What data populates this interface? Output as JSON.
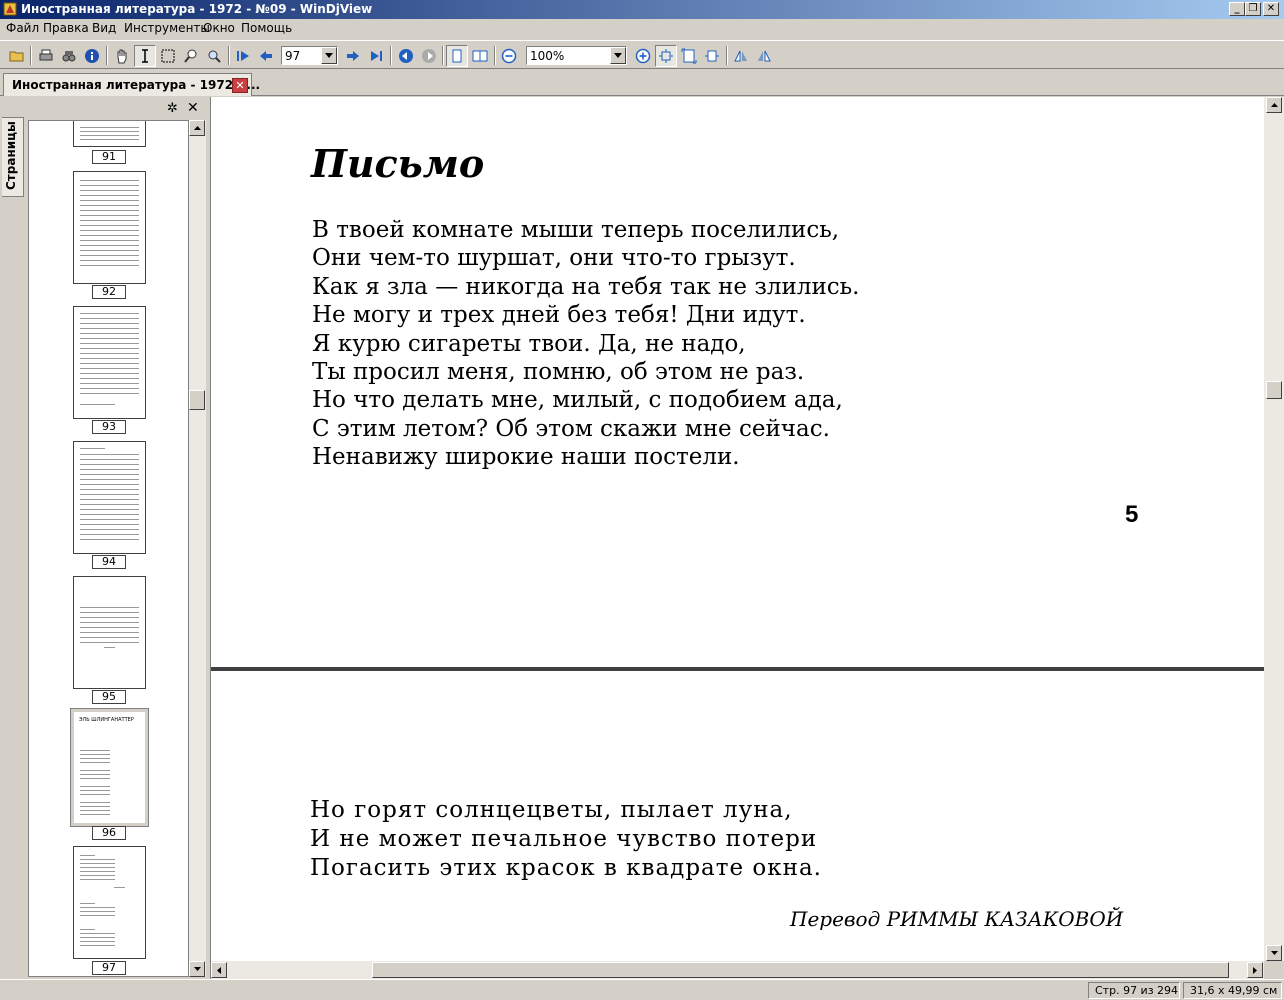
{
  "window": {
    "title": "Иностранная литература - 1972 - №09 - WinDjView",
    "controls": [
      "_",
      "❐",
      "✕"
    ]
  },
  "menu": [
    "Файл",
    "Правка",
    "Вид",
    "Инструменты",
    "Окно",
    "Помощь"
  ],
  "toolbar": {
    "page_value": "97",
    "zoom_value": "100%"
  },
  "tab": {
    "label": "Иностранная литература - 1972 - ..."
  },
  "sidebar": {
    "tab_label": "Страницы",
    "thumbnails": [
      {
        "page": "91"
      },
      {
        "page": "92"
      },
      {
        "page": "93"
      },
      {
        "page": "94"
      },
      {
        "page": "95"
      },
      {
        "page": "96"
      },
      {
        "page": "97"
      }
    ],
    "thumb96_heading": "ЭЛЬ ШЛИНГАНАТТЕР"
  },
  "document": {
    "title": "Письмо",
    "lines": [
      "В твоей комнате мыши теперь поселились,",
      "Они чем-то шуршат, они что-то грызут.",
      "Как я зла — никогда на тебя так не злились.",
      "Не могу и трех дней без тебя! Дни идут.",
      "Я курю сигареты твои. Да, не надо,",
      "Ты просил меня, помню, об этом не раз.",
      "Но что делать мне, милый, с подобием ада,",
      "С этим летом? Об этом скажи мне сейчас.",
      "Ненавижу широкие наши постели."
    ],
    "page_number": "5",
    "lines_page2": [
      "Но горят солнцецветы, пылает луна,",
      "И не может печальное чувство потери",
      "Погасить этих красок в квадрате окна."
    ],
    "translator": "Перевод РИММЫ КАЗАКОВОЙ"
  },
  "status": {
    "page_info": "Стр. 97 из 294",
    "page_size": "31,6 x 49,99 см"
  }
}
